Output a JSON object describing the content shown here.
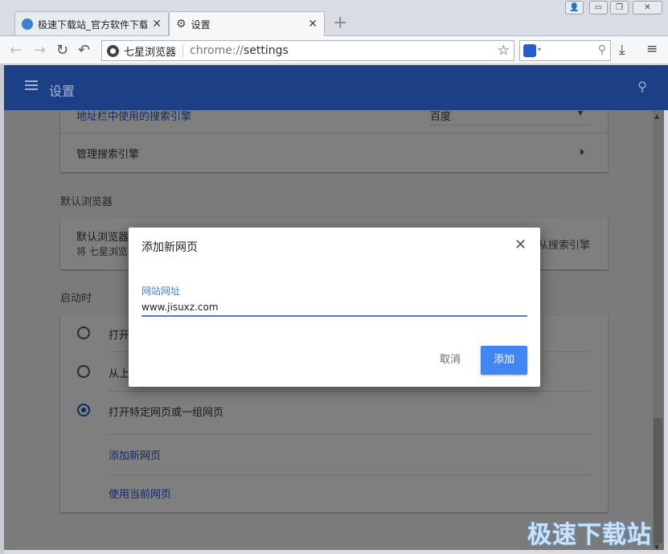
{
  "browser": {
    "tabs": [
      {
        "title": "极速下载站_官方软件下载",
        "icon": "globe-icon",
        "close": "✕"
      },
      {
        "title": "设置",
        "icon": "gear-icon",
        "close": "✕"
      }
    ],
    "new_tab": "+",
    "address": {
      "browser_name": "七星浏览器",
      "url_scheme": "chrome://",
      "url_path": "settings"
    }
  },
  "settings": {
    "header_title": "设置",
    "search_engine_row": "地址栏中使用的搜索引擎",
    "search_engine_value": "百度",
    "manage_search_engines": "管理搜索引擎",
    "default_browser_section": "默认浏览器",
    "default_browser_row": "默认浏览器",
    "default_browser_desc": "将 七星浏览",
    "default_browser_right": "从搜索引擎",
    "startup_section": "启动时",
    "startup_options": [
      {
        "label": "打开",
        "checked": false
      },
      {
        "label": "从上",
        "checked": false
      },
      {
        "label": "打开特定网页或一组网页",
        "checked": true
      }
    ],
    "add_new_page_link": "添加新网页",
    "use_current_pages_link": "使用当前网页"
  },
  "dialog": {
    "title": "添加新网页",
    "field_label": "网站网址",
    "field_value": "www.jisuxz.com",
    "cancel_label": "取消",
    "add_label": "添加"
  },
  "watermark": "极速下载站",
  "colors": {
    "header": "#1d3f85",
    "accent": "#4285f4",
    "link": "#4a7fd6"
  }
}
